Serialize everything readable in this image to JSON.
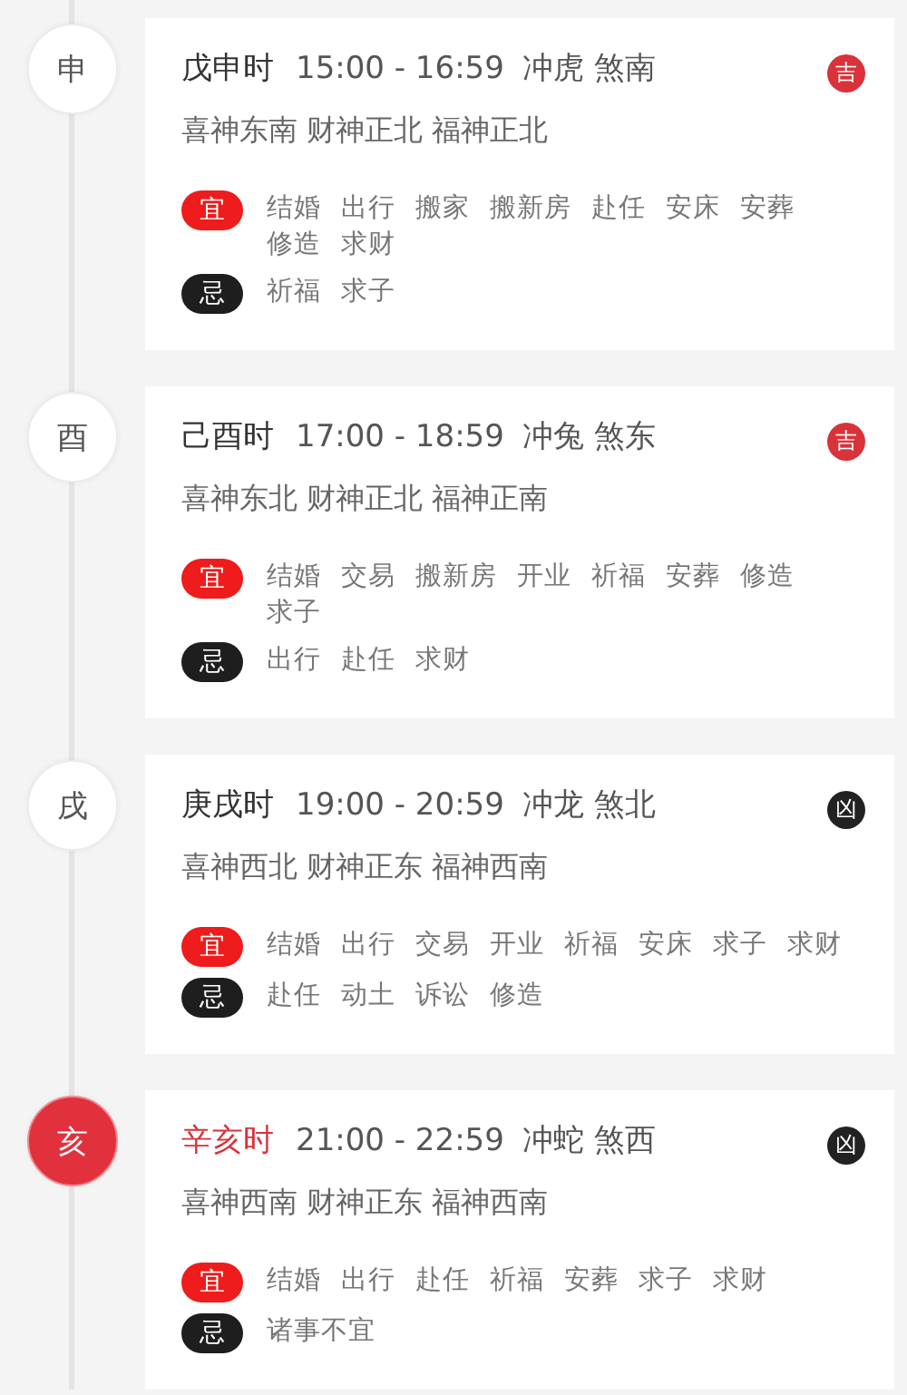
{
  "hours": [
    {
      "branch": "申",
      "selected": false,
      "name": "戊申时",
      "time": "15:00 - 16:59",
      "clash": "冲虎 煞南",
      "gods": "喜神东南 财神正北 福神正北",
      "grade": {
        "text": "吉",
        "kind": "good"
      },
      "yi_label": "宜",
      "yi": [
        "结婚",
        "出行",
        "搬家",
        "搬新房",
        "赴任",
        "安床",
        "安葬",
        "修造",
        "求财"
      ],
      "ji_label": "忌",
      "ji": [
        "祈福",
        "求子"
      ]
    },
    {
      "branch": "酉",
      "selected": false,
      "name": "己酉时",
      "time": "17:00 - 18:59",
      "clash": "冲兔 煞东",
      "gods": "喜神东北 财神正北 福神正南",
      "grade": {
        "text": "吉",
        "kind": "good"
      },
      "yi_label": "宜",
      "yi": [
        "结婚",
        "交易",
        "搬新房",
        "开业",
        "祈福",
        "安葬",
        "修造",
        "求子"
      ],
      "ji_label": "忌",
      "ji": [
        "出行",
        "赴任",
        "求财"
      ]
    },
    {
      "branch": "戌",
      "selected": false,
      "name": "庚戌时",
      "time": "19:00 - 20:59",
      "clash": "冲龙 煞北",
      "gods": "喜神西北 财神正东 福神西南",
      "grade": {
        "text": "凶",
        "kind": "bad"
      },
      "yi_label": "宜",
      "yi": [
        "结婚",
        "出行",
        "交易",
        "开业",
        "祈福",
        "安床",
        "求子",
        "求财"
      ],
      "ji_label": "忌",
      "ji": [
        "赴任",
        "动土",
        "诉讼",
        "修造"
      ]
    },
    {
      "branch": "亥",
      "selected": true,
      "name": "辛亥时",
      "time": "21:00 - 22:59",
      "clash": "冲蛇 煞西",
      "gods": "喜神西南 财神正东 福神西南",
      "grade": {
        "text": "凶",
        "kind": "bad"
      },
      "yi_label": "宜",
      "yi": [
        "结婚",
        "出行",
        "赴任",
        "祈福",
        "安葬",
        "求子",
        "求财"
      ],
      "ji_label": "忌",
      "ji": [
        "诸事不宜"
      ]
    }
  ]
}
